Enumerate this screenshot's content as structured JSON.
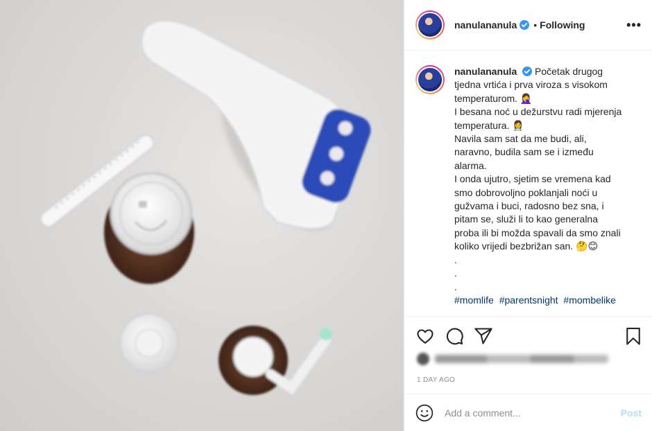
{
  "post": {
    "author": "nanulananula",
    "follow_dot": "•",
    "follow_status": "Following",
    "more_label": "•••"
  },
  "caption": {
    "author": "nanulananula",
    "lines": [
      "Početak drugog",
      "tjedna vrtića i prva viroza s visokom",
      "temperaturom. 🤦‍♀️",
      "I besana noć u dežurstvu radi mjerenja",
      "temperatura. 👩‍⚕️",
      "Navila sam sat da me budi, ali,",
      "naravno, budila sam se i između",
      "alarma.",
      "I onda ujutro, sjetim se vremena kad",
      "smo dobrovoljno poklanjali noći u",
      "gužvama i buci, radosno bez sna, i",
      "pitam se, služi li to kao generalna",
      "proba ili bi možda spavali da smo znali",
      "koliko vrijedi bezbrižan san. 🤔😊",
      ".",
      ".",
      "."
    ],
    "hashtags": [
      "#momlife",
      "#parentsnight",
      "#mombelike"
    ]
  },
  "meta": {
    "time_ago": "1 DAY AGO"
  },
  "comment": {
    "placeholder": "Add a comment...",
    "post_label": "Post"
  },
  "colors": {
    "link": "#00376b",
    "post_disabled": "#b2dffc",
    "verified": "#3897f0",
    "thermometer_blue": "#2a4bb8"
  },
  "icons": [
    "heart-icon",
    "comment-icon",
    "share-icon",
    "bookmark-icon",
    "emoji-icon",
    "verified-icon",
    "more-icon"
  ]
}
